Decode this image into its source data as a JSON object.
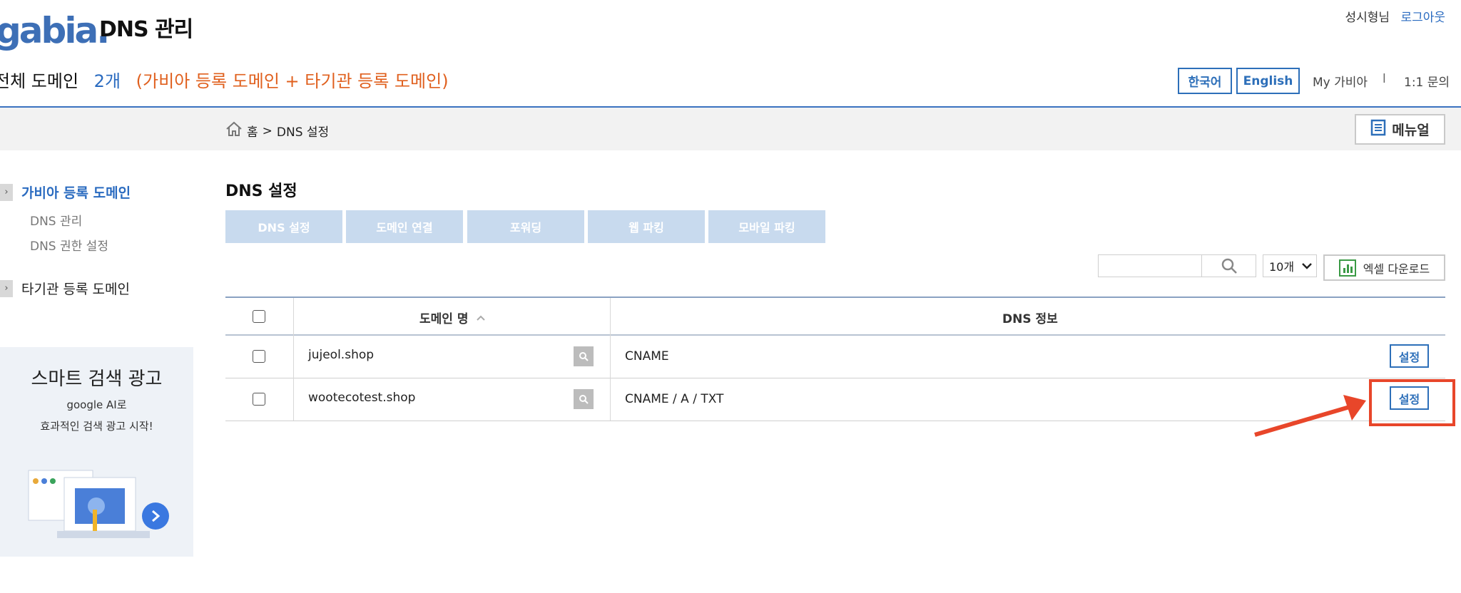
{
  "header": {
    "logo_text": "gabia",
    "app_title": "DNS 관리",
    "user_name": "성시형님",
    "logout_label": "로그아웃"
  },
  "summary": {
    "label": "전체 도메인",
    "count": "2개",
    "description": "(가비아 등록 도메인 + 타기관 등록 도메인)"
  },
  "top_nav": {
    "lang_ko": "한국어",
    "lang_en": "English",
    "my_gabia": "My 가비아",
    "separator": "l",
    "inquiry": "1:1 문의"
  },
  "breadcrumb": {
    "home": "홈",
    "sep": ">",
    "current": "DNS 설정"
  },
  "manual_label": "메뉴얼",
  "sidebar": {
    "gabia_domains": "가비아 등록 도메인",
    "dns_manage": "DNS 관리",
    "dns_permission": "DNS 권한 설정",
    "other_domains": "타기관 등록 도메인"
  },
  "ad": {
    "title": "스마트 검색 광고",
    "line1": "google AI로",
    "line2": "효과적인 검색 광고 시작!"
  },
  "main": {
    "title": "DNS 설정",
    "tabs": [
      "DNS 설정",
      "도메인 연결",
      "포워딩",
      "웹 파킹",
      "모바일 파킹"
    ],
    "page_size": "10개",
    "excel_label": "엑셀 다운로드"
  },
  "table": {
    "col_domain": "도메인 명",
    "sort_icon": "^",
    "col_dns": "DNS 정보",
    "rows": [
      {
        "domain": "jujeol.shop",
        "dns": "CNAME",
        "action": "설정"
      },
      {
        "domain": "wootecotest.shop",
        "dns": "CNAME / A / TXT",
        "action": "설정"
      }
    ]
  },
  "colors": {
    "brand_blue": "#2d6fb9",
    "accent_orange": "#e0601e",
    "annotation_red": "#e8462a",
    "tab_bg": "#c8daee"
  },
  "icons": [
    "home-icon",
    "manual-icon",
    "search-icon",
    "chevron-down-icon",
    "excel-icon",
    "magnifier-icon",
    "chevron-right-icon",
    "arrow-annotation-icon"
  ]
}
